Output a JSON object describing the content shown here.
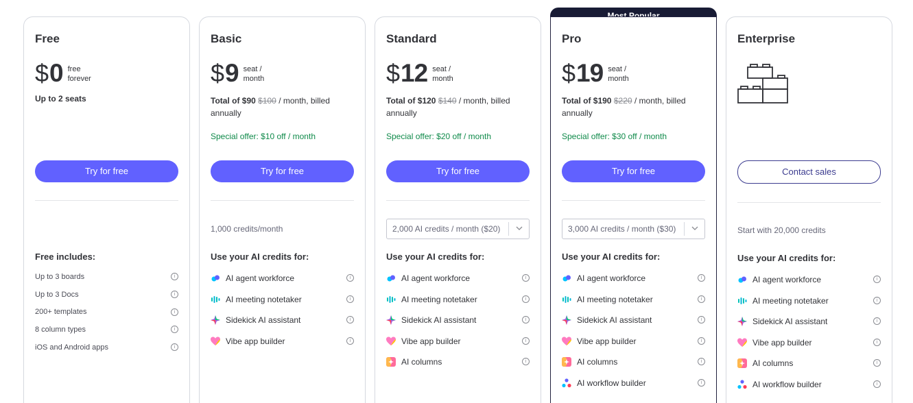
{
  "popular_badge": "Most Popular",
  "plans": [
    {
      "name": "Free",
      "currency": "$",
      "amount": "0",
      "unit_line1": "free",
      "unit_line2": "forever",
      "seats": "Up to 2 seats",
      "cta": "Try for free",
      "features_title": "Free includes:",
      "features": [
        "Up to 3 boards",
        "Up to 3 Docs",
        "200+ templates",
        "8 column types",
        "iOS and Android apps"
      ]
    },
    {
      "name": "Basic",
      "currency": "$",
      "amount": "9",
      "unit_line1": "seat /",
      "unit_line2": "month",
      "total_prefix": "Total of $90",
      "total_strike": "$100",
      "total_suffix": "/ month, billed annually",
      "offer": "Special offer: $10 off / month",
      "cta": "Try for free",
      "credits": "1,000 credits/month",
      "features_title": "Use your AI credits for:",
      "features": [
        "AI agent workforce",
        "AI meeting notetaker",
        "Sidekick AI assistant",
        "Vibe app builder"
      ]
    },
    {
      "name": "Standard",
      "currency": "$",
      "amount": "12",
      "unit_line1": "seat /",
      "unit_line2": "month",
      "total_prefix": "Total of $120",
      "total_strike": "$140",
      "total_suffix": "/ month, billed annually",
      "offer": "Special offer: $20 off / month",
      "cta": "Try for free",
      "credits_select": "2,000 AI credits / month ($20)",
      "features_title": "Use your AI credits for:",
      "features": [
        "AI agent workforce",
        "AI meeting notetaker",
        "Sidekick AI assistant",
        "Vibe app builder",
        "AI columns"
      ]
    },
    {
      "name": "Pro",
      "currency": "$",
      "amount": "19",
      "unit_line1": "seat /",
      "unit_line2": "month",
      "total_prefix": "Total of $190",
      "total_strike": "$220",
      "total_suffix": "/ month, billed annually",
      "offer": "Special offer: $30 off / month",
      "cta": "Try for free",
      "credits_select": "3,000 AI credits / month ($30)",
      "features_title": "Use your AI credits for:",
      "features": [
        "AI agent workforce",
        "AI meeting notetaker",
        "Sidekick AI assistant",
        "Vibe app builder",
        "AI columns",
        "AI workflow builder"
      ]
    },
    {
      "name": "Enterprise",
      "cta": "Contact sales",
      "credits": "Start with 20,000 credits",
      "features_title": "Use your AI credits for:",
      "features": [
        "AI agent workforce",
        "AI meeting notetaker",
        "Sidekick AI assistant",
        "Vibe app builder",
        "AI columns",
        "AI workflow builder"
      ]
    }
  ],
  "colors": {
    "primary": "#6161ff",
    "offer_green": "#0f8a4a",
    "badge_bg": "#181b34"
  },
  "info_glyph": "i"
}
